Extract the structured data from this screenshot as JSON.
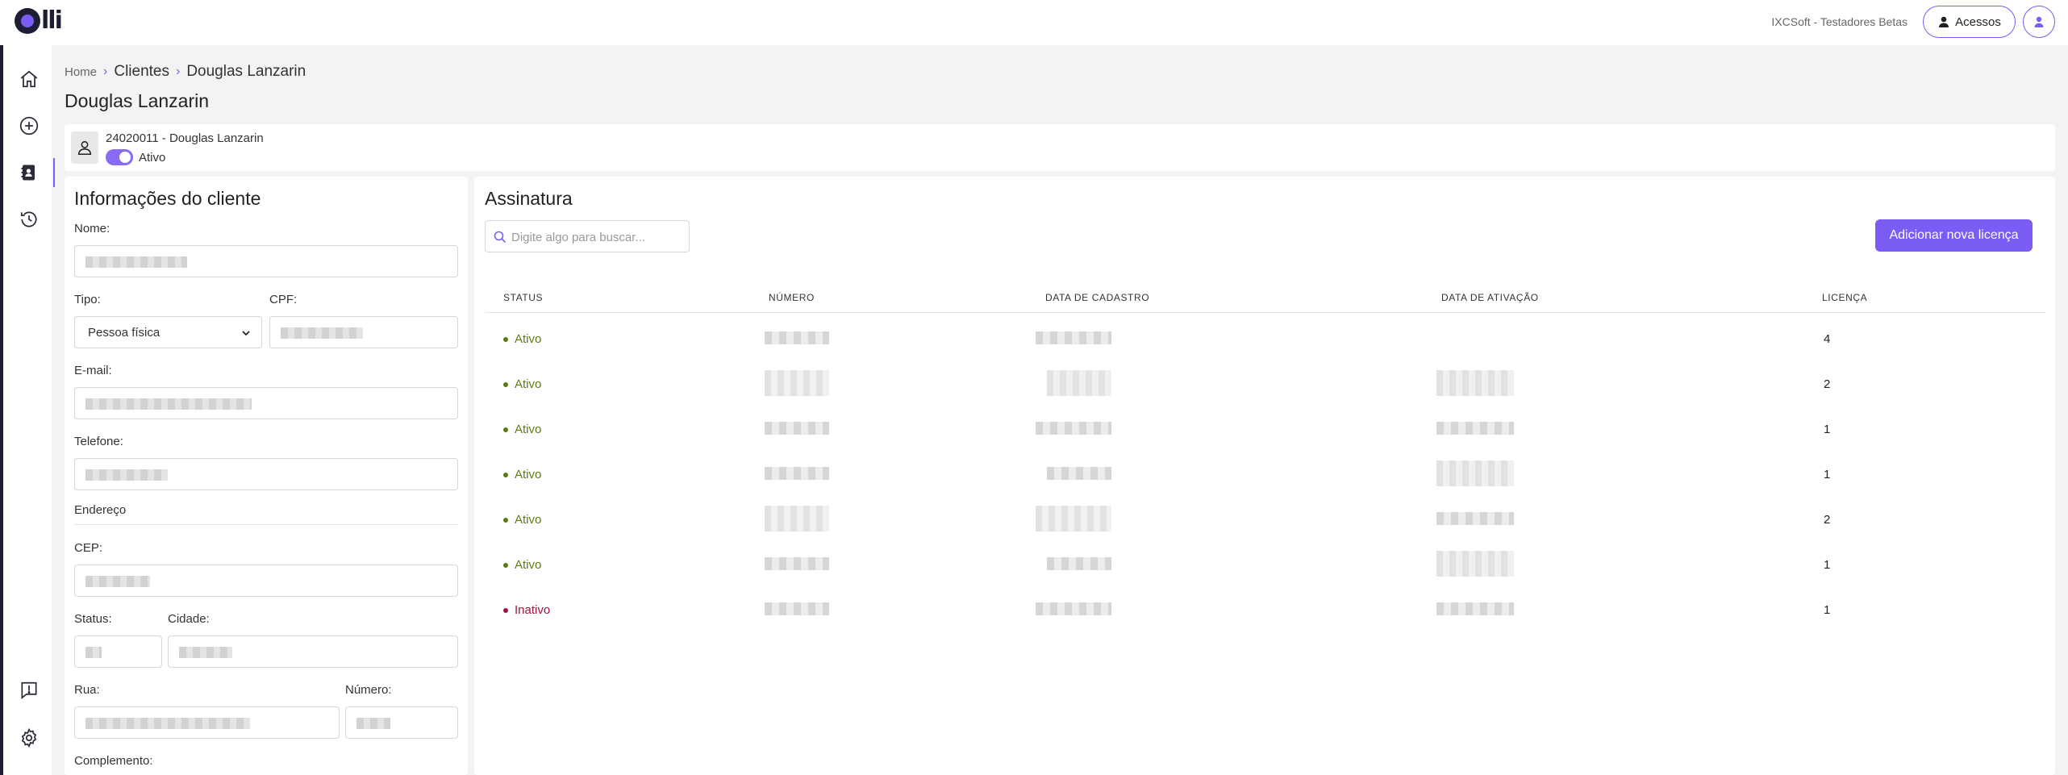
{
  "app": {
    "logo_text": "lli",
    "org_name": "IXCSoft - Testadores Betas",
    "acessos_label": "Acessos",
    "accent": "#7b5cf5",
    "dark": "#1d1d35"
  },
  "sidebar": {
    "items": [
      {
        "name": "home-icon"
      },
      {
        "name": "add-circle-icon"
      },
      {
        "name": "contacts-icon",
        "active": true
      },
      {
        "name": "history-icon"
      },
      {
        "name": "feedback-icon"
      },
      {
        "name": "settings-icon"
      }
    ]
  },
  "breadcrumb": {
    "home": "Home",
    "clientes": "Clientes",
    "current": "Douglas Lanzarin"
  },
  "page_title": "Douglas Lanzarin",
  "client": {
    "id_name": "24020011 - Douglas Lanzarin",
    "toggle_label": "Ativo",
    "toggle_on": true
  },
  "info": {
    "title": "Informações do cliente",
    "labels": {
      "nome": "Nome:",
      "tipo": "Tipo:",
      "cpf": "CPF:",
      "email": "E-mail:",
      "telefone": "Telefone:",
      "endereco": "Endereço",
      "cep": "CEP:",
      "status": "Status:",
      "cidade": "Cidade:",
      "rua": "Rua:",
      "numero": "Número:",
      "complemento": "Complemento:"
    },
    "tipo_value": "Pessoa física"
  },
  "subscription": {
    "title": "Assinatura",
    "search_placeholder": "Digite algo para buscar...",
    "add_label": "Adicionar nova licença",
    "columns": [
      "STATUS",
      "NÚMERO",
      "DATA DE CADASTRO",
      "DATA DE ATIVAÇÃO",
      "LICENÇA"
    ],
    "rows": [
      {
        "status": "Ativo",
        "licenca": "4",
        "has_ativacao": false
      },
      {
        "status": "Ativo",
        "licenca": "2",
        "has_ativacao": true
      },
      {
        "status": "Ativo",
        "licenca": "1",
        "has_ativacao": true
      },
      {
        "status": "Ativo",
        "licenca": "1",
        "has_ativacao": true
      },
      {
        "status": "Ativo",
        "licenca": "2",
        "has_ativacao": true
      },
      {
        "status": "Ativo",
        "licenca": "1",
        "has_ativacao": true
      },
      {
        "status": "Inativo",
        "licenca": "1",
        "has_ativacao": true
      }
    ],
    "status_colors": {
      "Ativo": "#5b7a0f",
      "Inativo": "#a0143c"
    }
  }
}
